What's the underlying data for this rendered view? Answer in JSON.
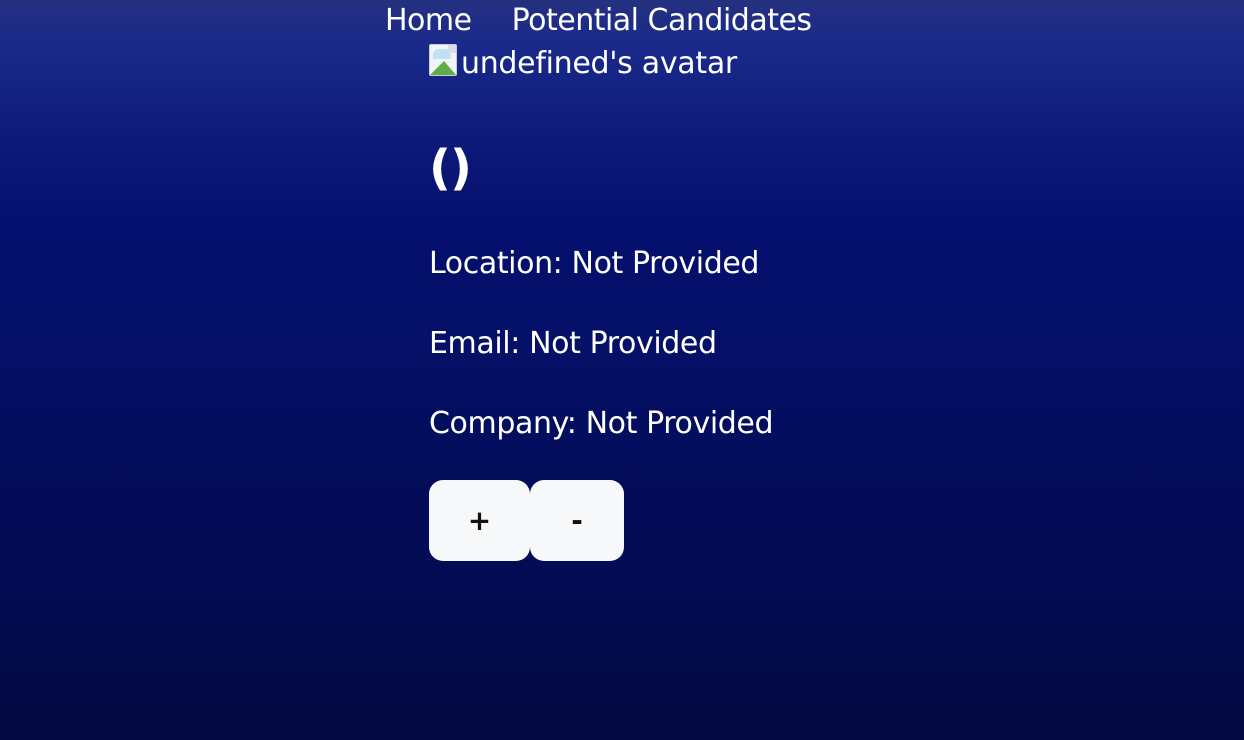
{
  "nav": {
    "home_label": "Home",
    "candidates_label": "Potential Candidates"
  },
  "candidate": {
    "avatar_alt": "undefined's avatar",
    "name_line": "()",
    "location": "Location: Not Provided",
    "email": "Email: Not Provided",
    "company": "Company: Not Provided"
  },
  "actions": {
    "add_label": "+",
    "remove_label": "-"
  },
  "icons": {
    "avatar": "broken-image-icon"
  },
  "colors": {
    "background_top": "#25307f",
    "background_mid": "#050f6e",
    "background_bottom": "#020840",
    "button_bg": "#f7f8f9",
    "text": "#ffffff"
  }
}
